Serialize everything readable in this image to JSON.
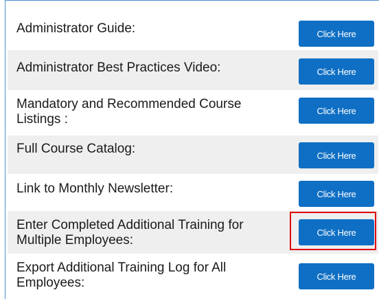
{
  "rows": [
    {
      "label": "Administrator Guide:",
      "button_label": "Click Here"
    },
    {
      "label": "Administrator Best Practices Video:",
      "button_label": "Click Here"
    },
    {
      "label": "Mandatory and Recommended Course Listings :",
      "button_label": "Click Here"
    },
    {
      "label": "Full Course Catalog:",
      "button_label": "Click Here"
    },
    {
      "label": "Link to Monthly Newsletter:",
      "button_label": "Click Here"
    },
    {
      "label": "Enter Completed Additional Training for Multiple Employees:",
      "button_label": "Click Here",
      "highlighted": true
    },
    {
      "label": "Export Additional Training Log for All Employees:",
      "button_label": "Click Here"
    }
  ],
  "colors": {
    "button_bg": "#0f6fc4",
    "button_text": "#ffffff",
    "row_shade": "#efefef",
    "highlight_border": "#e00000",
    "panel_border": "#4a8fd0"
  }
}
